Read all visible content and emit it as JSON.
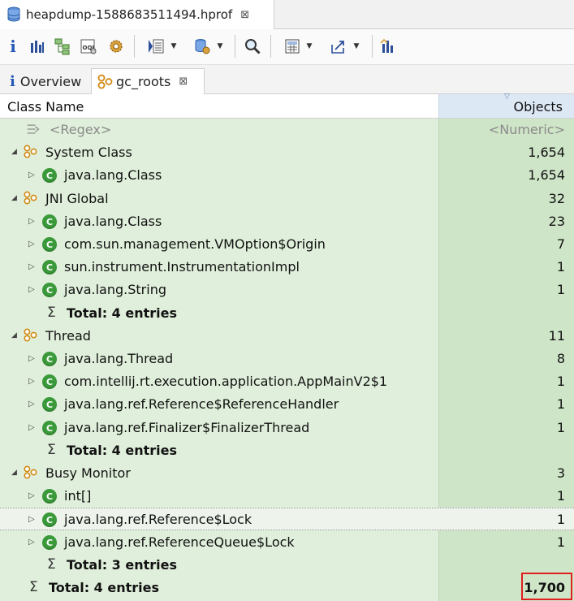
{
  "editor_tab": {
    "title": "heapdump-1588683511494.hprof",
    "close": "⊠"
  },
  "toolbar": {
    "info": "i",
    "dropdown_caret": "▼"
  },
  "subtabs": {
    "overview": {
      "icon": "i",
      "label": "Overview"
    },
    "gc_roots": {
      "label": "gc_roots",
      "close": "⊠"
    }
  },
  "table": {
    "headers": {
      "class_name": "Class Name",
      "objects": "Objects"
    },
    "filter": {
      "name": "<Regex>",
      "objects": "<Numeric>"
    },
    "rows": [
      {
        "kind": "group",
        "label": "System Class",
        "value": "1,654"
      },
      {
        "kind": "class",
        "label": "java.lang.Class",
        "value": "1,654"
      },
      {
        "kind": "group",
        "label": "JNI Global",
        "value": "32"
      },
      {
        "kind": "class",
        "label": "java.lang.Class",
        "value": "23"
      },
      {
        "kind": "class",
        "label": "com.sun.management.VMOption$Origin",
        "value": "7"
      },
      {
        "kind": "class",
        "label": "sun.instrument.InstrumentationImpl",
        "value": "1"
      },
      {
        "kind": "class",
        "label": "java.lang.String",
        "value": "1"
      },
      {
        "kind": "total",
        "label": "Total: 4 entries",
        "value": ""
      },
      {
        "kind": "group",
        "label": "Thread",
        "value": "11"
      },
      {
        "kind": "class",
        "label": "java.lang.Thread",
        "value": "8"
      },
      {
        "kind": "class",
        "label": "com.intellij.rt.execution.application.AppMainV2$1",
        "value": "1"
      },
      {
        "kind": "class",
        "label": "java.lang.ref.Reference$ReferenceHandler",
        "value": "1"
      },
      {
        "kind": "class",
        "label": "java.lang.ref.Finalizer$FinalizerThread",
        "value": "1"
      },
      {
        "kind": "total",
        "label": "Total: 4 entries",
        "value": ""
      },
      {
        "kind": "group",
        "label": "Busy Monitor",
        "value": "3"
      },
      {
        "kind": "class",
        "label": "int[]",
        "value": "1"
      },
      {
        "kind": "class",
        "label": "java.lang.ref.Reference$Lock",
        "value": "1",
        "selected": true
      },
      {
        "kind": "class",
        "label": "java.lang.ref.ReferenceQueue$Lock",
        "value": "1"
      },
      {
        "kind": "total",
        "label": "Total: 3 entries",
        "value": ""
      }
    ],
    "grand_total": {
      "label": "Total: 4 entries",
      "value": "1,700"
    }
  },
  "colors": {
    "row_bg": "#e0efdb",
    "objects_col_bg": "#cfe5c8",
    "class_icon": "#3a9a3a",
    "highlight": "#e02020"
  }
}
